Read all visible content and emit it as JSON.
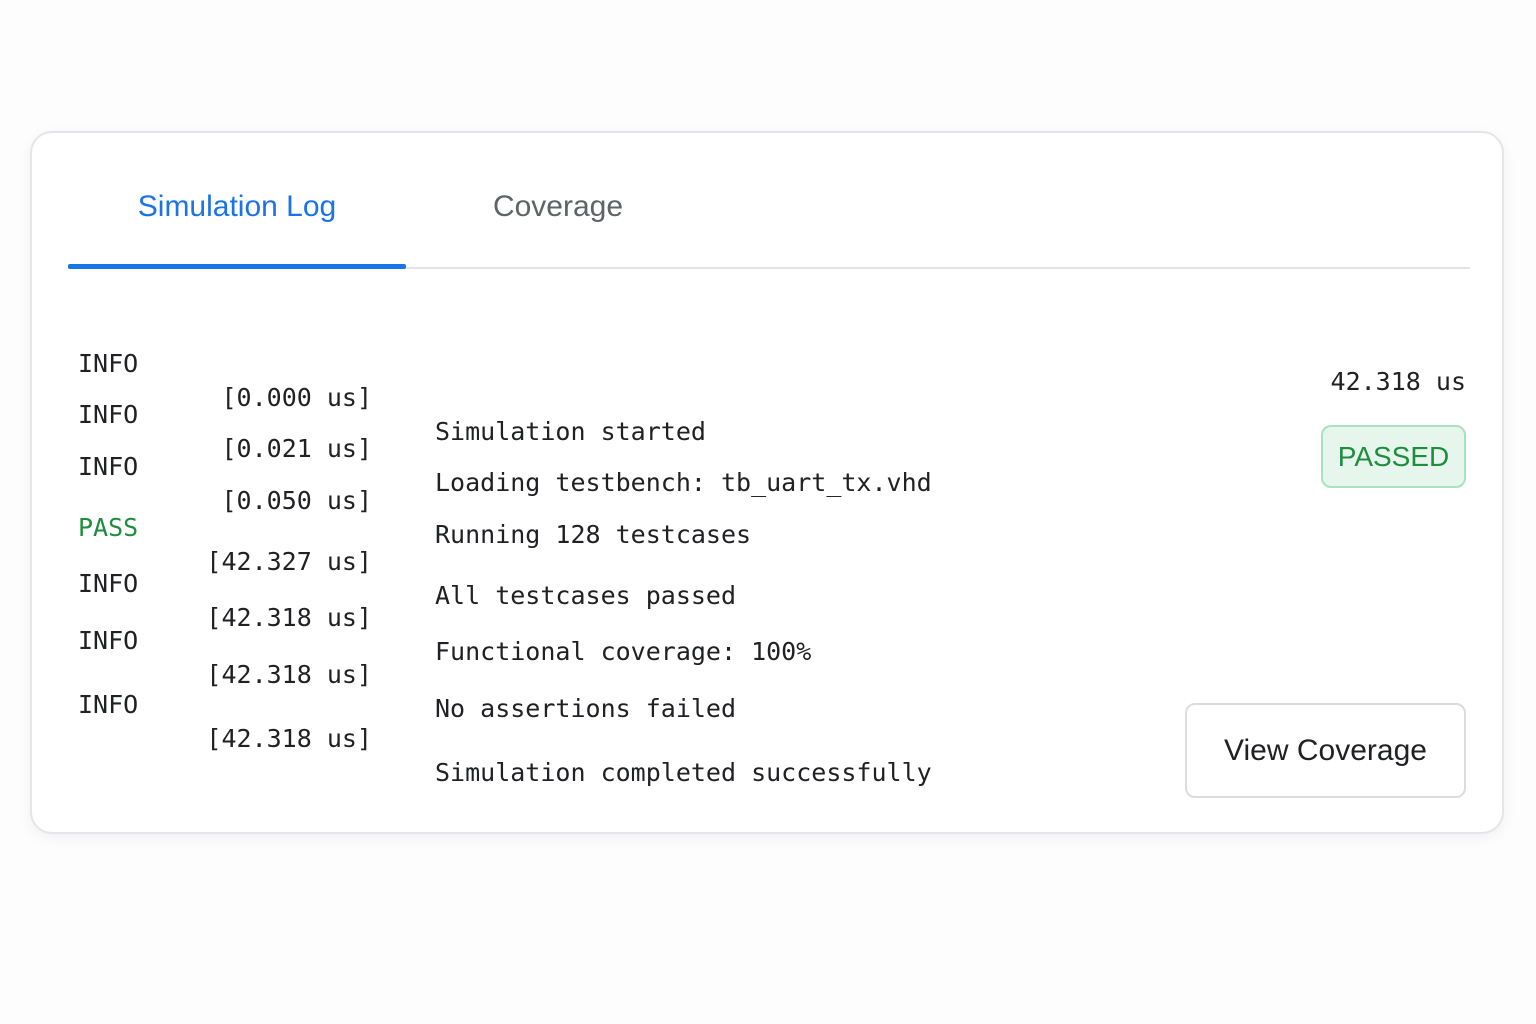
{
  "tabs": [
    {
      "label": "Simulation Log",
      "active": true
    },
    {
      "label": "Coverage",
      "active": false
    }
  ],
  "log": [
    {
      "level": "INFO",
      "timestamp": "[0.000 us]",
      "message": "Simulation started"
    },
    {
      "level": "INFO",
      "timestamp": "[0.021 us]",
      "message": "Loading testbench: tb_uart_tx.vhd"
    },
    {
      "level": "INFO",
      "timestamp": "[0.050 us]",
      "message": "Running 128 testcases"
    },
    {
      "level": "PASS",
      "timestamp": "[42.327 us]",
      "message": "All testcases passed"
    },
    {
      "level": "INFO",
      "timestamp": "[42.318 us]",
      "message": "Functional coverage: 100%"
    },
    {
      "level": "INFO",
      "timestamp": "[42.318 us]",
      "message": "No assertions failed"
    },
    {
      "level": "INFO",
      "timestamp": "[42.318 us]",
      "message": "Simulation completed successfully"
    }
  ],
  "summary": {
    "sim_time": "42.318 us",
    "status": "PASSED"
  },
  "actions": {
    "view_coverage_label": "View Coverage"
  },
  "colors": {
    "accent": "#1a73e8",
    "pass": "#1e8e3e",
    "pass_bg": "#e6f6ec"
  }
}
